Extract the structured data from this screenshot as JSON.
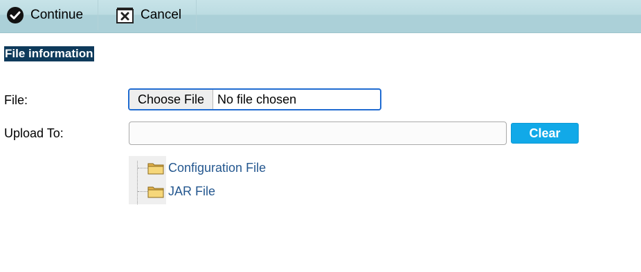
{
  "toolbar": {
    "continue_label": "Continue",
    "cancel_label": "Cancel"
  },
  "section": {
    "title": "File information"
  },
  "form": {
    "file_label": "File:",
    "choose_file_label": "Choose File",
    "file_status": "No file chosen",
    "upload_to_label": "Upload To:",
    "upload_to_value": "",
    "clear_label": "Clear"
  },
  "tree": {
    "items": [
      {
        "label": "Configuration File",
        "icon": "folder-icon"
      },
      {
        "label": "JAR File",
        "icon": "folder-icon"
      }
    ]
  },
  "colors": {
    "toolbar_bg": "#abd0d8",
    "section_title_bg": "#0e3a5b",
    "clear_button": "#11a9e8",
    "tree_link": "#24578f",
    "focus_border": "#1f6bd1"
  }
}
